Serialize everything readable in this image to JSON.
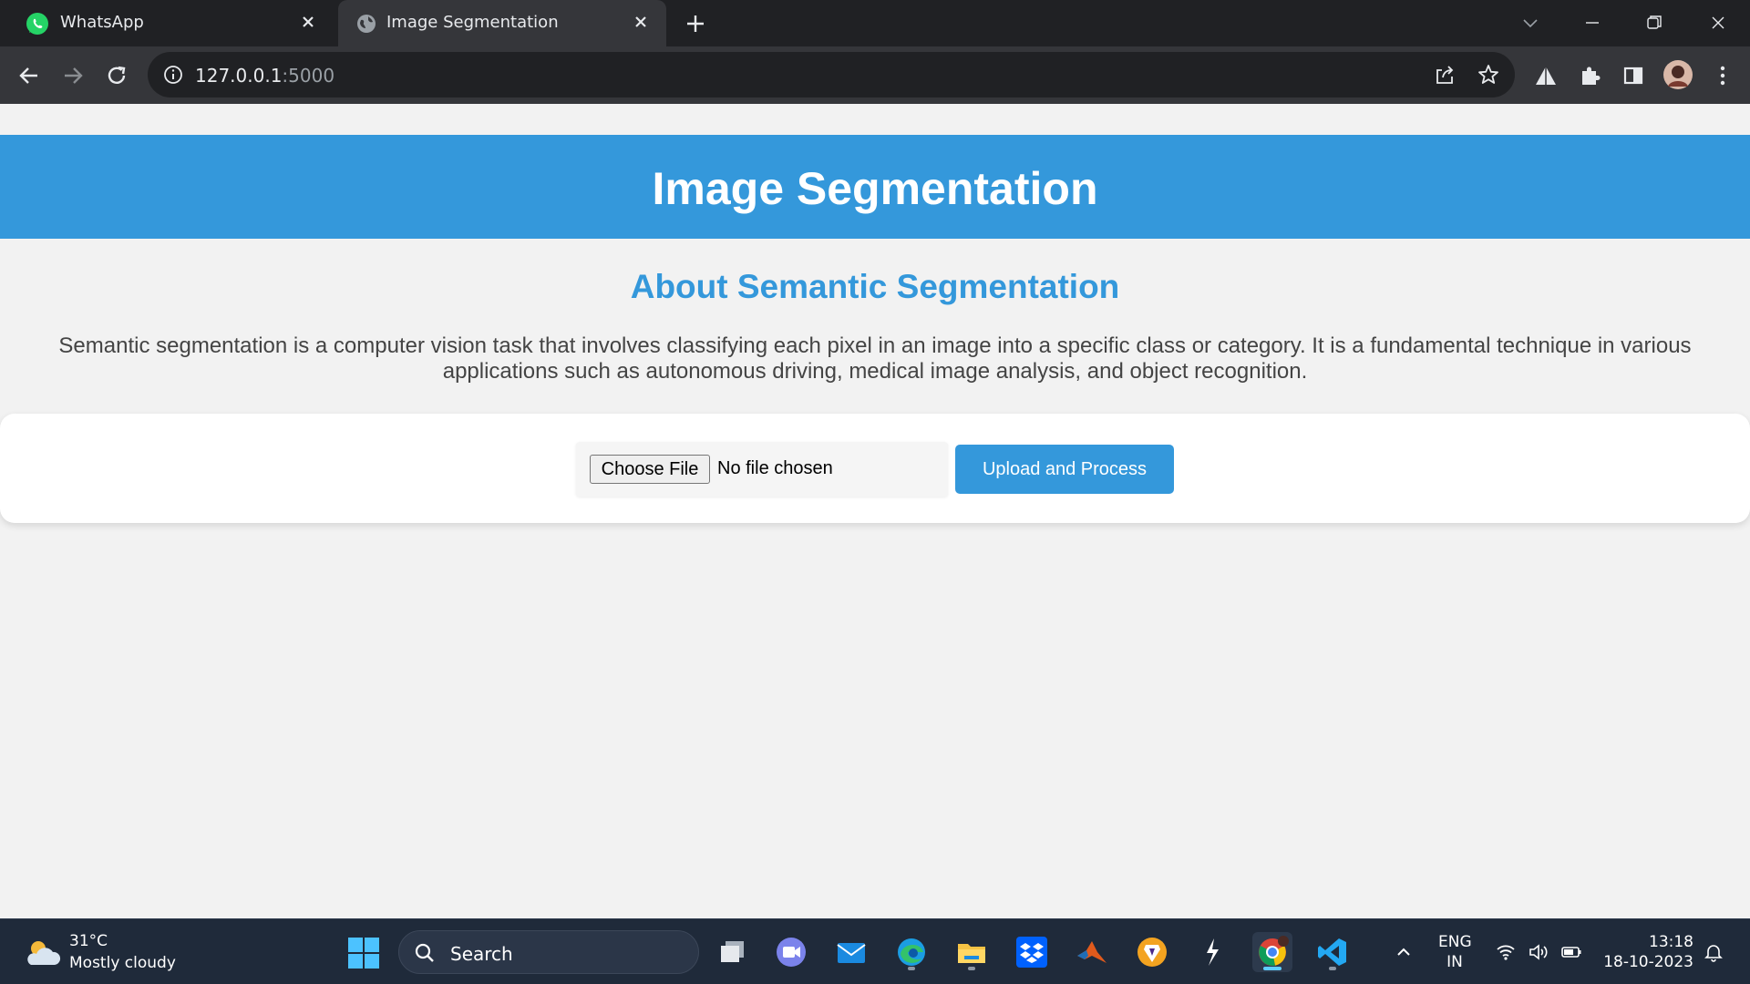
{
  "browser": {
    "tabs": [
      {
        "title": "WhatsApp",
        "icon": "whatsapp-icon",
        "active": false
      },
      {
        "title": "Image Segmentation",
        "icon": "globe-icon",
        "active": true
      }
    ],
    "url_host": "127.0.0.1",
    "url_port": ":5000"
  },
  "page": {
    "header_title": "Image Segmentation",
    "about_title": "About Semantic Segmentation",
    "about_text": "Semantic segmentation is a computer vision task that involves classifying each pixel in an image into a specific class or category. It is a fundamental technique in various applications such as autonomous driving, medical image analysis, and object recognition.",
    "choose_file_label": "Choose File",
    "no_file_text": "No file chosen",
    "upload_button_label": "Upload and Process",
    "accent_color": "#3498db"
  },
  "taskbar": {
    "weather_temp": "31°C",
    "weather_desc": "Mostly cloudy",
    "search_label": "Search",
    "lang_line1": "ENG",
    "lang_line2": "IN",
    "time": "13:18",
    "date": "18-10-2023",
    "apps": [
      "task-view-icon",
      "teams-chat-icon",
      "mail-icon",
      "edge-icon",
      "file-explorer-icon",
      "dropbox-icon",
      "matlab-icon",
      "brave-icon",
      "spark-icon",
      "chrome-icon",
      "vscode-icon"
    ]
  }
}
